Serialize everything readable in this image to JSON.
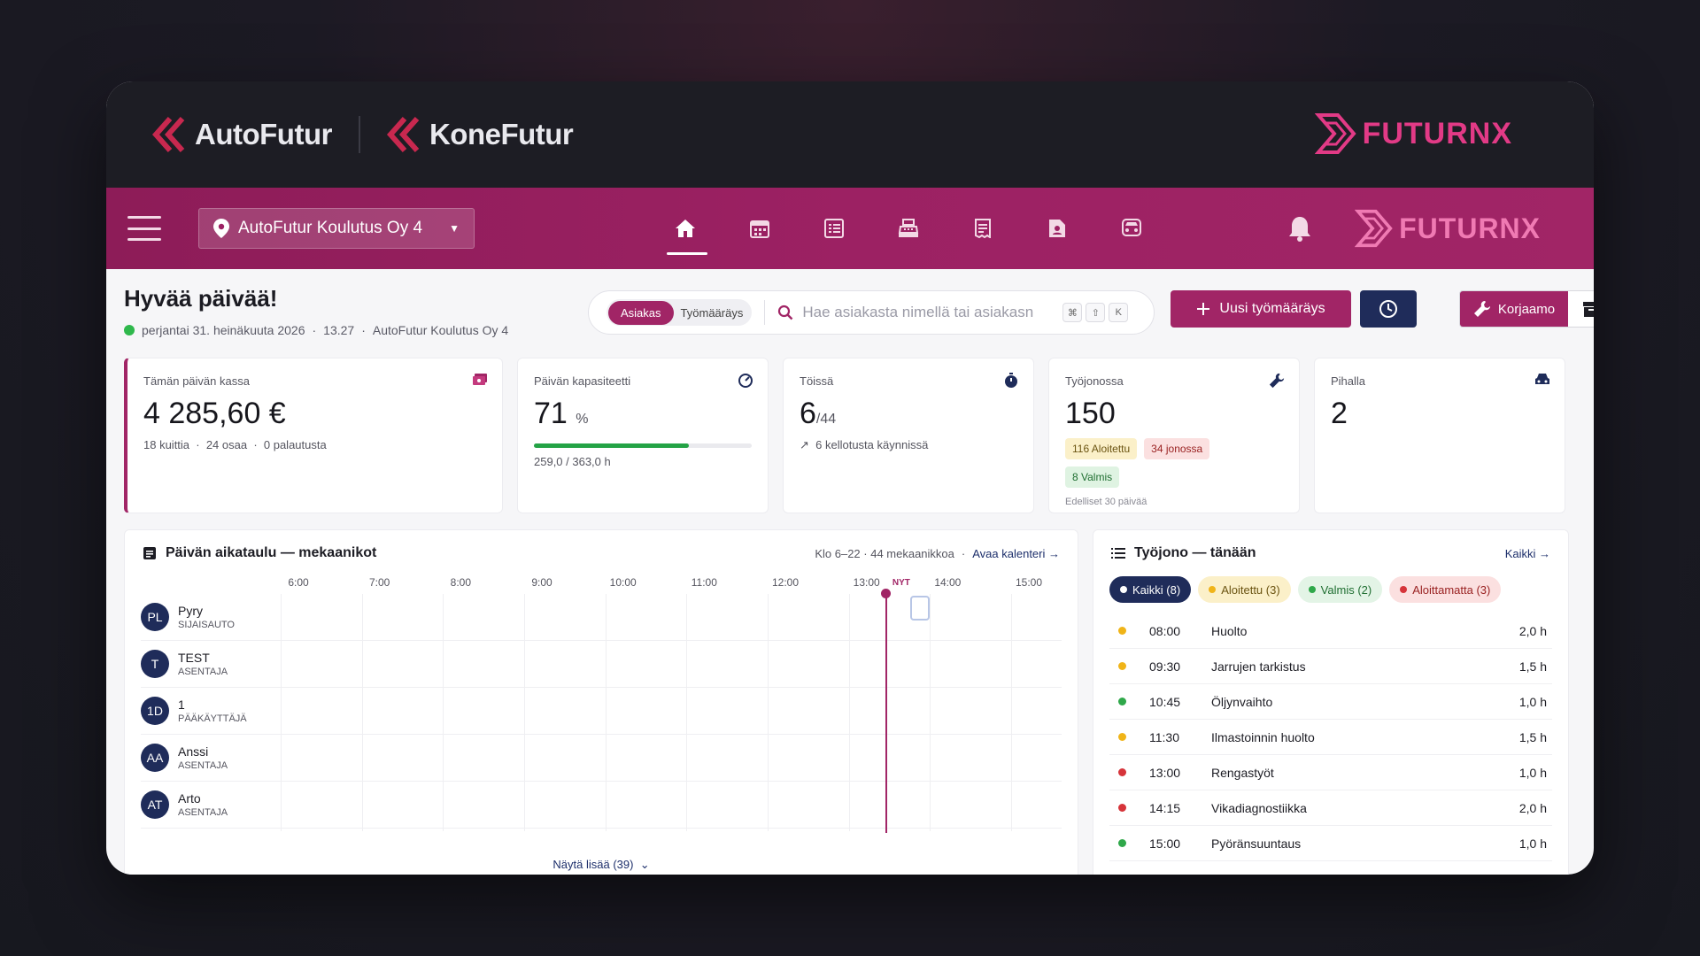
{
  "brands": {
    "left1": "AutoFutur",
    "left2": "KoneFutur",
    "right": "FUTURNX"
  },
  "nav": {
    "location": "AutoFutur Koulutus Oy 4",
    "logo": "FUTURNX",
    "icons": [
      "home-icon",
      "calendar-icon",
      "list-icon",
      "register-icon",
      "receipt-icon",
      "document-icon",
      "car-icon"
    ]
  },
  "header": {
    "greeting": "Hyvää päivää!",
    "date": "perjantai 31. heinäkuuta 2026",
    "time": "13.27",
    "company": "AutoFutur Koulutus Oy 4"
  },
  "search": {
    "seg_customer": "Asiakas",
    "seg_order": "Työmääräys",
    "placeholder": "Hae asiakasta nimellä tai asiakasn",
    "kbd": [
      "⌘",
      "⇧",
      "K"
    ]
  },
  "actions": {
    "new_order": "Uusi työmääräys",
    "workshop": "Korjaamo"
  },
  "stats": {
    "cash": {
      "label": "Tämän päivän kassa",
      "value": "4 285,60 €",
      "receipts": "18 kuittia",
      "parts": "24 osaa",
      "refunds": "0 palautusta"
    },
    "capacity": {
      "label": "Päivän kapasiteetti",
      "value": "71",
      "unit": "%",
      "fill": 0.71,
      "hours": "259,0 / 363,0 h"
    },
    "working": {
      "label": "Töissä",
      "value": "6",
      "total": "/44",
      "clocks": "6 kellotusta käynnissä"
    },
    "queue": {
      "label": "Työjonossa",
      "value": "150",
      "started": "116 Aloitettu",
      "queued": "34 jonossa",
      "done": "8 Valmis",
      "note": "Edelliset 30 päivää"
    },
    "yard": {
      "label": "Pihalla",
      "value": "2"
    }
  },
  "schedule": {
    "title": "Päivän aikataulu — mekaanikot",
    "info": "Klo 6–22 · 44 mekaanikkoa",
    "calendar_link": "Avaa kalenteri →",
    "hours": [
      "6:00",
      "7:00",
      "8:00",
      "9:00",
      "10:00",
      "11:00",
      "12:00",
      "13:00",
      "14:00",
      "15:00"
    ],
    "now_label": "NYT",
    "now_hour": 13.45,
    "mechanics": [
      {
        "initials": "PL",
        "name": "Pyry",
        "role": "SIJAISAUTO"
      },
      {
        "initials": "T",
        "name": "TEST",
        "role": "ASENTAJA"
      },
      {
        "initials": "1D",
        "name": "1",
        "role": "PÄÄKÄYTTÄJÄ"
      },
      {
        "initials": "AA",
        "name": "Anssi",
        "role": "ASENTAJA"
      },
      {
        "initials": "AT",
        "name": "Arto",
        "role": "ASENTAJA"
      }
    ],
    "more": "Näytä lisää (39)"
  },
  "queue": {
    "title": "Työjono — tänään",
    "all_link": "Kaikki →",
    "filters": {
      "all": "Kaikki (8)",
      "started": "Aloitettu (3)",
      "done": "Valmis (2)",
      "notstarted": "Aloittamatta (3)"
    },
    "items": [
      {
        "time": "08:00",
        "name": "Huolto",
        "dur": "2,0 h",
        "status": "#f0b418"
      },
      {
        "time": "09:30",
        "name": "Jarrujen tarkistus",
        "dur": "1,5 h",
        "status": "#f0b418"
      },
      {
        "time": "10:45",
        "name": "Öljynvaihto",
        "dur": "1,0 h",
        "status": "#2fa84a"
      },
      {
        "time": "11:30",
        "name": "Ilmastoinnin huolto",
        "dur": "1,5 h",
        "status": "#f0b418"
      },
      {
        "time": "13:00",
        "name": "Rengastyöt",
        "dur": "1,0 h",
        "status": "#d6343a"
      },
      {
        "time": "14:15",
        "name": "Vikadiagnostiikka",
        "dur": "2,0 h",
        "status": "#d6343a"
      },
      {
        "time": "15:00",
        "name": "Pyöränsuuntaus",
        "dur": "1,0 h",
        "status": "#2fa84a"
      }
    ]
  },
  "colors": {
    "brand": "#a12566",
    "navy": "#1f2c5a"
  }
}
